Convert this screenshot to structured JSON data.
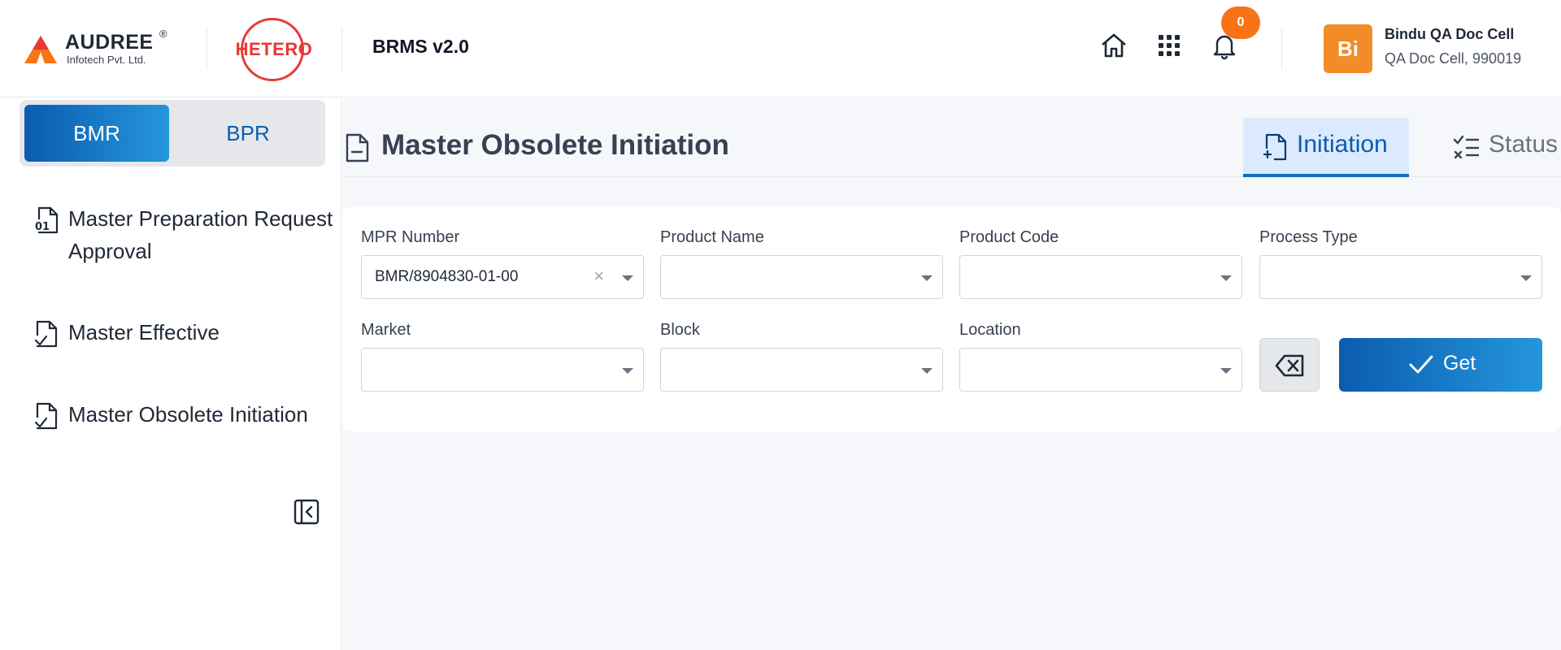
{
  "header": {
    "brand_name": "AUDREE",
    "brand_reg": "®",
    "brand_sub": "Infotech Pvt. Ltd.",
    "partner_logo": "HETERO",
    "app_title": "BRMS v2.0",
    "icons": [
      "home-icon",
      "apps-grid-icon",
      "bell-icon"
    ],
    "notification_count": "0",
    "user": {
      "initials": "Bi",
      "name": "Bindu QA Doc Cell",
      "dept": "QA Doc Cell, 990019"
    }
  },
  "sidebar": {
    "toggle": {
      "active": "BMR",
      "inactive": "BPR"
    },
    "items": [
      {
        "label": "Master Preparation Request Approval",
        "icon": "file-code-icon"
      },
      {
        "label": "Master Effective",
        "icon": "file-check-icon"
      },
      {
        "label": "Master Obsolete Initiation",
        "icon": "file-check-icon"
      }
    ]
  },
  "main": {
    "page_title": "Master Obsolete Initiation",
    "tabs": [
      {
        "label": "Initiation",
        "icon": "file-plus-icon",
        "active": true
      },
      {
        "label": "Status",
        "icon": "checklist-icon",
        "active": false
      }
    ],
    "form": {
      "fields": [
        {
          "label": "MPR Number",
          "value": "BMR/8904830-01-00",
          "clear": "×"
        },
        {
          "label": "Product Name",
          "value": ""
        },
        {
          "label": "Product Code",
          "value": ""
        },
        {
          "label": "Process Type",
          "value": ""
        },
        {
          "label": "Market",
          "value": ""
        },
        {
          "label": "Block",
          "value": ""
        },
        {
          "label": "Location",
          "value": ""
        }
      ],
      "get_label": "Get"
    }
  },
  "colors": {
    "primary": "#0b5cb0",
    "accent_orange": "#f97316",
    "avatar_orange": "#f28c28",
    "hetero_red": "#e53935"
  }
}
